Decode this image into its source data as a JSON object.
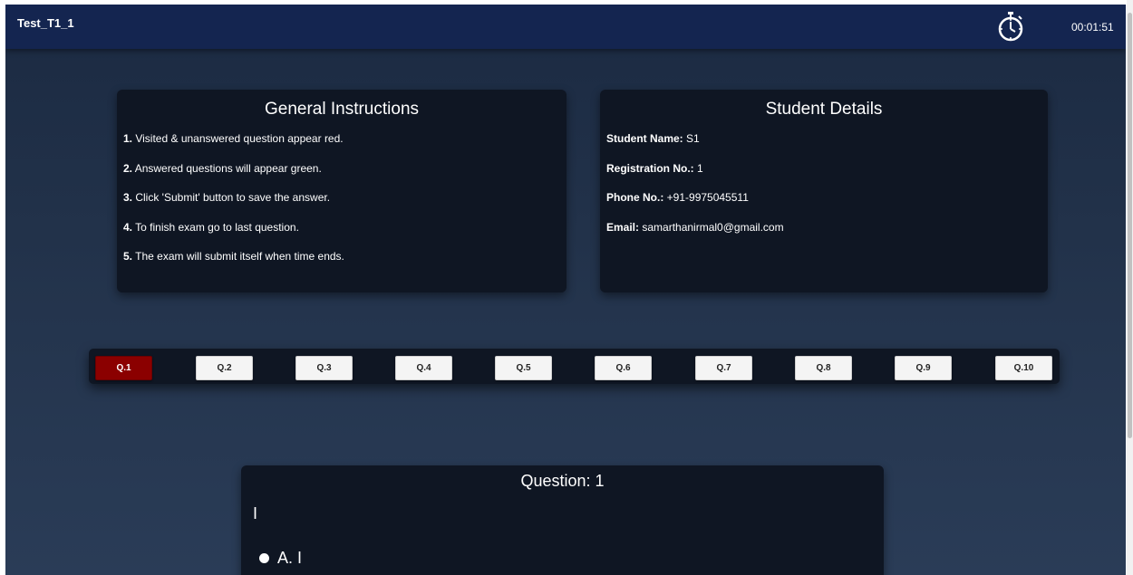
{
  "header": {
    "test_title": "Test_T1_1",
    "timer": "00:01:51",
    "timer_icon": "stopwatch-icon"
  },
  "instructions": {
    "title": "General Instructions",
    "items": [
      {
        "num": "1.",
        "text": " Visited & unanswered question appear red."
      },
      {
        "num": "2.",
        "text": " Answered questions will appear green."
      },
      {
        "num": "3.",
        "text": " Click 'Submit' button to save the answer."
      },
      {
        "num": "4.",
        "text": " To finish exam go to last question."
      },
      {
        "num": "5.",
        "text": " The exam will submit itself when time ends."
      }
    ]
  },
  "student": {
    "title": "Student Details",
    "fields": [
      {
        "label": "Student Name:",
        "value": " S1"
      },
      {
        "label": "Registration No.:",
        "value": " 1"
      },
      {
        "label": "Phone No.:",
        "value": " +91-9975045511"
      },
      {
        "label": "Email:",
        "value": " samarthanirmal0@gmail.com"
      }
    ]
  },
  "question_nav": {
    "buttons": [
      "Q.1",
      "Q.2",
      "Q.3",
      "Q.4",
      "Q.5",
      "Q.6",
      "Q.7",
      "Q.8",
      "Q.9",
      "Q.10"
    ],
    "active_index": 0,
    "active_color": "#8b0000"
  },
  "question": {
    "title": "Question: 1",
    "text": "I",
    "options": [
      {
        "label": "A. I"
      }
    ]
  },
  "colors": {
    "header_bg": "#142550",
    "panel_bg": "#0f1623"
  }
}
